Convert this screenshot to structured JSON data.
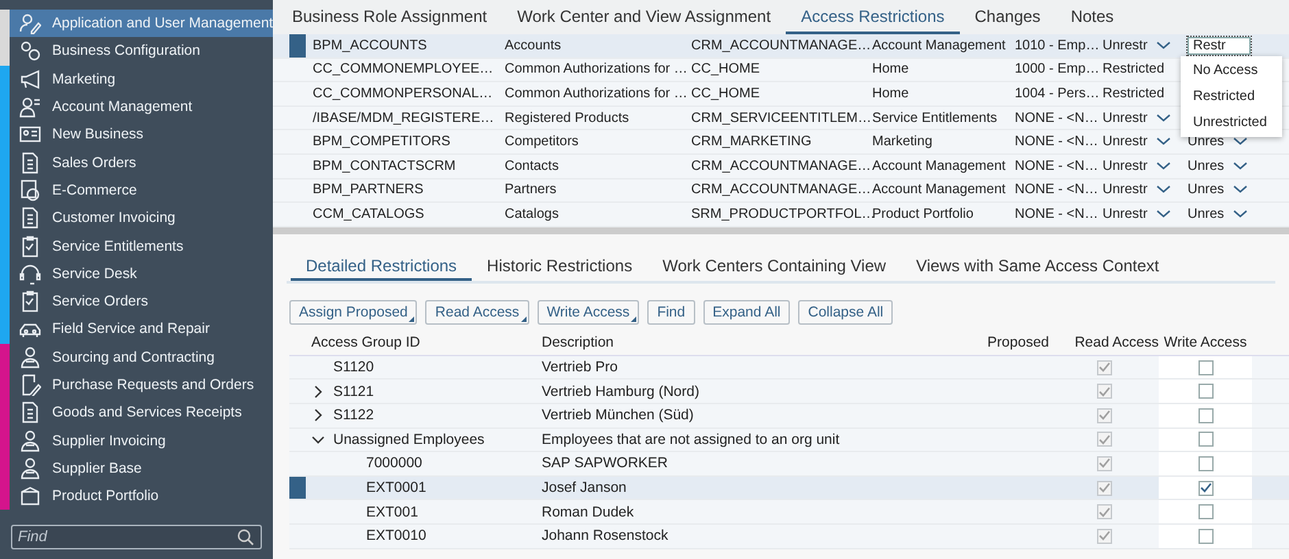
{
  "sidebar": {
    "items": [
      {
        "label": "Application and User Management",
        "selected": true,
        "color": "#d9d9d9"
      },
      {
        "label": "Business Configuration",
        "selected": false,
        "color": "#d9d9d9"
      },
      {
        "label": "Marketing",
        "selected": false,
        "color": "#1ea7f0"
      },
      {
        "label": "Account Management",
        "selected": false,
        "color": "#1ea7f0"
      },
      {
        "label": "New Business",
        "selected": false,
        "color": "#1ea7f0"
      },
      {
        "label": "Sales Orders",
        "selected": false,
        "color": "#1ea7f0"
      },
      {
        "label": "E-Commerce",
        "selected": false,
        "color": "#1ea7f0"
      },
      {
        "label": "Customer Invoicing",
        "selected": false,
        "color": "#1ea7f0"
      },
      {
        "label": "Service Entitlements",
        "selected": false,
        "color": "#1ea7f0"
      },
      {
        "label": "Service Desk",
        "selected": false,
        "color": "#1ea7f0"
      },
      {
        "label": "Service Orders",
        "selected": false,
        "color": "#1ea7f0"
      },
      {
        "label": "Field Service and Repair",
        "selected": false,
        "color": "#1ea7f0"
      },
      {
        "label": "Sourcing and Contracting",
        "selected": false,
        "color": "#d4148c"
      },
      {
        "label": "Purchase Requests and Orders",
        "selected": false,
        "color": "#d4148c"
      },
      {
        "label": "Goods and Services Receipts",
        "selected": false,
        "color": "#d4148c"
      },
      {
        "label": "Supplier Invoicing",
        "selected": false,
        "color": "#d4148c"
      },
      {
        "label": "Supplier Base",
        "selected": false,
        "color": "#d4148c"
      },
      {
        "label": "Product Portfolio",
        "selected": false,
        "color": "#d4148c"
      }
    ],
    "search": {
      "placeholder": "Find"
    }
  },
  "tabs": [
    {
      "label": "Business Role Assignment",
      "selected": false
    },
    {
      "label": "Work Center and View Assignment",
      "selected": false
    },
    {
      "label": "Access Restrictions",
      "selected": true
    },
    {
      "label": "Changes",
      "selected": false
    },
    {
      "label": "Notes",
      "selected": false
    }
  ],
  "views": {
    "rows": [
      {
        "selected": true,
        "id": "BPM_ACCOUNTS",
        "name": "Accounts",
        "view": "CRM_ACCOUNTMANAGE…",
        "work_center": "Account Management",
        "context": "1010 - Emp…",
        "read": {
          "kind": "dropdown",
          "value": "Unrestr"
        },
        "write": {
          "kind": "input",
          "value": "Restr"
        }
      },
      {
        "selected": false,
        "id": "CC_COMMONEMPLOYEE…",
        "name": "Common Authorizations for …",
        "view": "CC_HOME",
        "work_center": "Home",
        "context": "1000 - Emp…",
        "read": {
          "kind": "text",
          "value": "Restricted"
        }
      },
      {
        "selected": false,
        "id": "CC_COMMONPERSONAL…",
        "name": "Common Authorizations for …",
        "view": "CC_HOME",
        "work_center": "Home",
        "context": "1004 - Pers…",
        "read": {
          "kind": "text",
          "value": "Restricted"
        }
      },
      {
        "selected": false,
        "id": "/IBASE/MDM_REGISTERE…",
        "name": "Registered Products",
        "view": "CRM_SERVICEENTITLEM…",
        "work_center": "Service Entitlements",
        "context": "NONE - <N…",
        "read": {
          "kind": "dropdown",
          "value": "Unrestr"
        }
      },
      {
        "selected": false,
        "id": "BPM_COMPETITORS",
        "name": "Competitors",
        "view": "CRM_MARKETING",
        "work_center": "Marketing",
        "context": "NONE - <N…",
        "read": {
          "kind": "dropdown",
          "value": "Unrestr"
        },
        "write": {
          "kind": "dropdown",
          "value": "Unres"
        }
      },
      {
        "selected": false,
        "id": "BPM_CONTACTSCRM",
        "name": "Contacts",
        "view": "CRM_ACCOUNTMANAGE…",
        "work_center": "Account Management",
        "context": "NONE - <N…",
        "read": {
          "kind": "dropdown",
          "value": "Unrestr"
        },
        "write": {
          "kind": "dropdown",
          "value": "Unres"
        }
      },
      {
        "selected": false,
        "id": "BPM_PARTNERS",
        "name": "Partners",
        "view": "CRM_ACCOUNTMANAGE…",
        "work_center": "Account Management",
        "context": "NONE - <N…",
        "read": {
          "kind": "dropdown",
          "value": "Unrestr"
        },
        "write": {
          "kind": "dropdown",
          "value": "Unres"
        }
      },
      {
        "selected": false,
        "id": "CCM_CATALOGS",
        "name": "Catalogs",
        "view": "SRM_PRODUCTPORTFOL…",
        "work_center": "Product Portfolio",
        "context": "NONE - <N…",
        "read": {
          "kind": "dropdown",
          "value": "Unrestr"
        },
        "write": {
          "kind": "dropdown",
          "value": "Unres"
        }
      }
    ]
  },
  "dropdown_menu": {
    "items": [
      "No Access",
      "Restricted",
      "Unrestricted"
    ]
  },
  "detail_tabs": [
    {
      "label": "Detailed Restrictions",
      "selected": true
    },
    {
      "label": "Historic Restrictions",
      "selected": false
    },
    {
      "label": "Work Centers Containing View",
      "selected": false
    },
    {
      "label": "Views with Same Access Context",
      "selected": false
    }
  ],
  "toolbar": [
    {
      "label": "Assign Proposed",
      "has_menu": true
    },
    {
      "label": "Read Access",
      "has_menu": true
    },
    {
      "label": "Write Access",
      "has_menu": true
    },
    {
      "label": "Find",
      "has_menu": false
    },
    {
      "label": "Expand All",
      "has_menu": false
    },
    {
      "label": "Collapse All",
      "has_menu": false
    }
  ],
  "groups": {
    "columns": [
      "Access Group ID",
      "Description",
      "Proposed",
      "Read Access",
      "Write Access"
    ],
    "rows": [
      {
        "id": "S1120",
        "description": "Vertrieb Pro",
        "selected": false,
        "read": true,
        "write": false
      },
      {
        "id": "S1121",
        "description": "Vertrieb Hamburg (Nord)",
        "expanded": false,
        "selected": false,
        "read": true,
        "write": false
      },
      {
        "id": "S1122",
        "description": "Vertrieb München (Süd)",
        "expanded": false,
        "selected": false,
        "read": true,
        "write": false
      },
      {
        "id": "Unassigned Employees",
        "description": "Employees that are not assigned to an org unit",
        "expanded": true,
        "selected": false,
        "read": true,
        "write": false,
        "children": [
          {
            "id": "7000000",
            "description": "SAP SAPWORKER",
            "selected": false,
            "read": true,
            "write": false
          },
          {
            "id": "EXT0001",
            "description": "Josef Janson",
            "selected": true,
            "read": true,
            "write": true
          },
          {
            "id": "EXT001",
            "description": "Roman Dudek",
            "selected": false,
            "read": true,
            "write": false
          },
          {
            "id": "EXT0010",
            "description": "Johann Rosenstock",
            "selected": false,
            "read": true,
            "write": false
          }
        ]
      }
    ]
  }
}
